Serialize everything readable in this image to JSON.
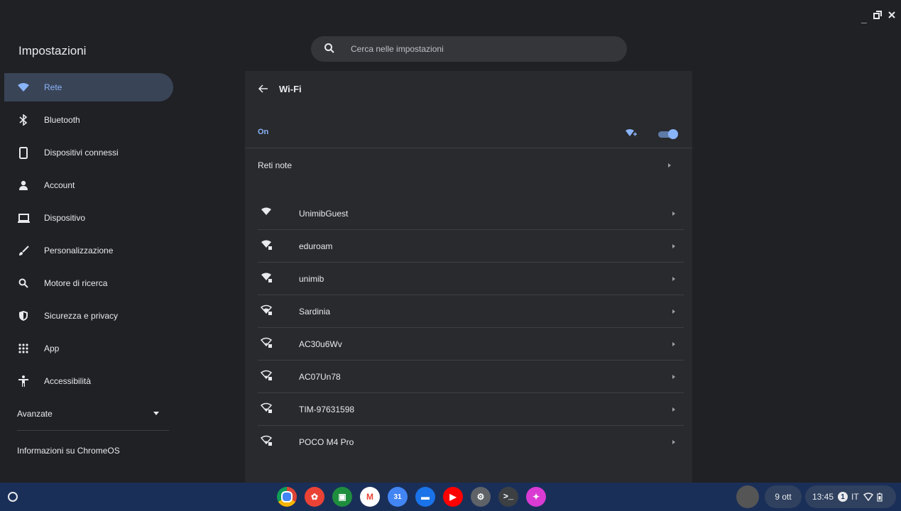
{
  "window": {
    "title": "Impostazioni",
    "controls": [
      "minimize",
      "restore",
      "close"
    ]
  },
  "search": {
    "placeholder": "Cerca nelle impostazioni"
  },
  "sidebar": {
    "items": [
      {
        "label": "Rete",
        "icon": "wifi-icon",
        "active": true
      },
      {
        "label": "Bluetooth",
        "icon": "bluetooth-icon"
      },
      {
        "label": "Dispositivi connessi",
        "icon": "phone-icon"
      },
      {
        "label": "Account",
        "icon": "person-icon"
      },
      {
        "label": "Dispositivo",
        "icon": "laptop-icon"
      },
      {
        "label": "Personalizzazione",
        "icon": "brush-icon"
      },
      {
        "label": "Motore di ricerca",
        "icon": "search-icon"
      },
      {
        "label": "Sicurezza e privacy",
        "icon": "shield-icon"
      },
      {
        "label": "App",
        "icon": "apps-grid-icon"
      },
      {
        "label": "Accessibilità",
        "icon": "accessibility-icon"
      }
    ],
    "advanced": "Avanzate",
    "about": "Informazioni su ChromeOS"
  },
  "wifi": {
    "title": "Wi-Fi",
    "status": "On",
    "enabled": true,
    "known_networks": "Reti note",
    "networks": [
      {
        "name": "UnimibGuest",
        "secured": false,
        "strength": "full"
      },
      {
        "name": "eduroam",
        "secured": true,
        "strength": "full"
      },
      {
        "name": "unimib",
        "secured": true,
        "strength": "full"
      },
      {
        "name": "Sardinia",
        "secured": true,
        "strength": "medium"
      },
      {
        "name": "AC30u6Wv",
        "secured": true,
        "strength": "low"
      },
      {
        "name": "AC07Un78",
        "secured": true,
        "strength": "low"
      },
      {
        "name": "TIM-97631598",
        "secured": true,
        "strength": "low"
      },
      {
        "name": "POCO M4 Pro",
        "secured": true,
        "strength": "low"
      }
    ]
  },
  "shelf": {
    "apps": [
      {
        "name": "chrome-icon",
        "color": "#db4437"
      },
      {
        "name": "canvas-icon",
        "color": "#ea4335"
      },
      {
        "name": "classroom-icon",
        "color": "#1e8e3e"
      },
      {
        "name": "gmail-icon",
        "color": "#ffffff"
      },
      {
        "name": "calendar-icon",
        "color": "#4285f4"
      },
      {
        "name": "files-icon",
        "color": "#1a73e8"
      },
      {
        "name": "youtube-icon",
        "color": "#ff0000"
      },
      {
        "name": "settings-icon",
        "color": "#5f6368"
      },
      {
        "name": "terminal-icon",
        "color": "#3c4043"
      },
      {
        "name": "screencast-icon",
        "color": "#d93bd3"
      }
    ],
    "date": "9 ott",
    "time": "13:45",
    "notification_count": "1",
    "ime": "IT"
  }
}
